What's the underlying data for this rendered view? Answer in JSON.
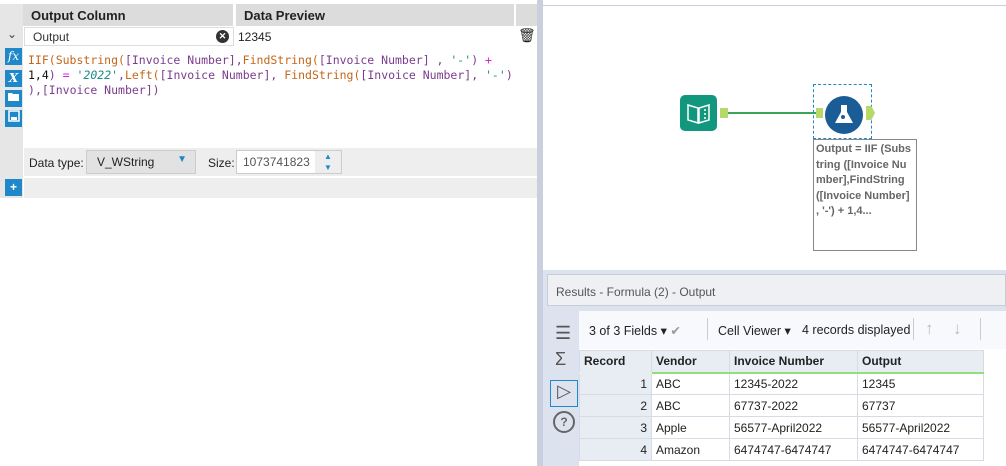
{
  "formula_editor": {
    "headers": {
      "output_column": "Output Column",
      "data_preview": "Data Preview"
    },
    "field": {
      "name": "Output",
      "preview": "12345"
    },
    "formula_tokens": [
      [
        "fn",
        "IIF("
      ],
      [
        "fn",
        "Substring("
      ],
      [
        "fld",
        "[Invoice Number]"
      ],
      [
        "punc",
        ","
      ],
      [
        "fn",
        "FindString("
      ],
      [
        "fld",
        "[Invoice Number]"
      ],
      [
        "punc",
        " , "
      ],
      [
        "str",
        "'-'"
      ],
      [
        "punc",
        ") "
      ],
      [
        "op",
        "+"
      ],
      [
        "num",
        "\n1,4"
      ],
      [
        "punc",
        ") "
      ],
      [
        "op",
        "="
      ],
      [
        "str",
        " '2022'"
      ],
      [
        "punc",
        ","
      ],
      [
        "fn",
        "Left("
      ],
      [
        "fld",
        "[Invoice Number]"
      ],
      [
        "punc",
        ", "
      ],
      [
        "fn",
        "FindString("
      ],
      [
        "fld",
        "[Invoice Number]"
      ],
      [
        "punc",
        ", "
      ],
      [
        "str",
        "'-'"
      ],
      [
        "punc",
        ")\n)"
      ],
      [
        "punc",
        ","
      ],
      [
        "fld",
        "[Invoice Number]"
      ],
      [
        "punc",
        ")"
      ]
    ],
    "data_type_label": "Data type:",
    "data_type": "V_WString",
    "size_label": "Size:",
    "size": "1073741823",
    "icons": {
      "fx": "fx",
      "var": "X"
    }
  },
  "canvas": {
    "annotation": "Output = IIF (Substring ([Invoice Number],FindString([Invoice Number] , '-') + 1,4..."
  },
  "results": {
    "title": "Results - Formula (2) - Output",
    "fields_label": "3 of 3 Fields",
    "viewer": "Cell Viewer",
    "records_label": "4 records displayed",
    "columns": [
      "Record",
      "Vendor",
      "Invoice Number",
      "Output"
    ],
    "rows": [
      [
        "1",
        "ABC",
        "12345-2022",
        "12345"
      ],
      [
        "2",
        "ABC",
        "67737-2022",
        "67737"
      ],
      [
        "3",
        "Apple",
        "56577-April2022",
        "56577-April2022"
      ],
      [
        "4",
        "Amazon",
        "6474747-6474747",
        "6474747-6474747"
      ]
    ]
  },
  "colors": {
    "accent": "#1e88c8",
    "connection": "#3aa556",
    "formula_tool": "#1a5d96",
    "input_tool": "#12977f"
  }
}
